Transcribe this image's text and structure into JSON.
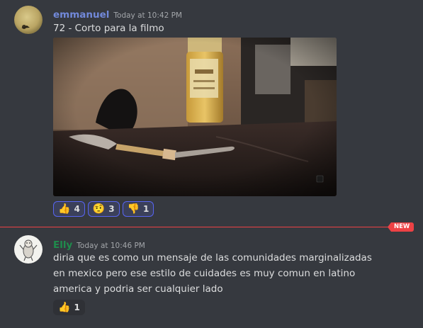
{
  "messages": [
    {
      "username": "emmanuel",
      "username_color": "#7289da",
      "timestamp": "Today at 10:42 PM",
      "text": "72 - Corto para la filmo",
      "reactions": [
        {
          "emoji": "thumbs-up",
          "glyph": "👍",
          "count": "4",
          "me": true
        },
        {
          "emoji": "thinking-face",
          "glyph": "🤨",
          "count": "3",
          "me": true
        },
        {
          "emoji": "thumbs-down",
          "glyph": "👎",
          "count": "1",
          "me": true
        }
      ]
    },
    {
      "username": "Elly",
      "username_color": "#1f8b4c",
      "timestamp": "Today at 10:46 PM",
      "text": "diria que es como un mensaje de las comunidades marginalizadas en mexico pero ese estilo de cuidades es muy comun en latino america y podria ser cualquier lado",
      "reactions": [
        {
          "emoji": "thumbs-up",
          "glyph": "👍",
          "count": "1",
          "me": false
        }
      ]
    }
  ],
  "divider": {
    "label": "NEW",
    "color": "#ed4245"
  }
}
